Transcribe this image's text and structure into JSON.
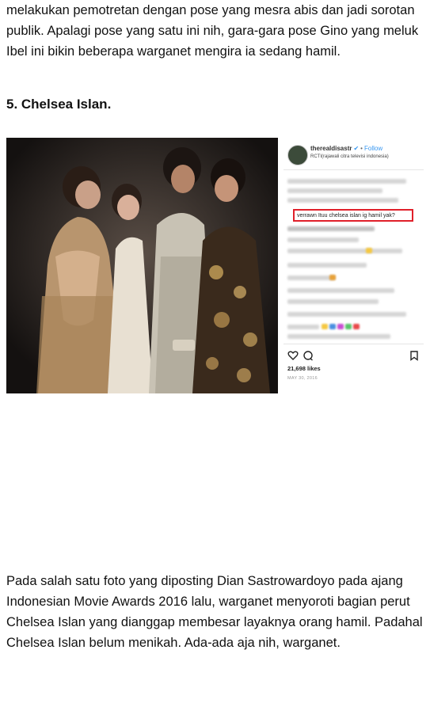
{
  "article": {
    "paragraph_top": "melakukan pemotretan dengan pose yang mesra abis dan jadi sorotan publik. Apalagi pose yang satu ini nih, gara-gara pose Gino yang meluk Ibel ini bikin beberapa warganet mengira ia sedang hamil.",
    "heading": "5. Chelsea Islan.",
    "paragraph_bottom": "Pada salah satu foto yang diposting Dian Sastrowardoyo pada ajang Indonesian Movie Awards 2016 lalu, warganet menyoroti bagian perut Chelsea Islan yang dianggap membesar layaknya orang hamil. Padahal Chelsea Islan belum menikah. Ada-ada aja nih, warganet."
  },
  "instagram": {
    "username": "therealdisastr",
    "verified_mark": "✔",
    "separator": "•",
    "follow_label": "Follow",
    "location": "RCTI(rajawali citra televisi indonesia)",
    "highlighted_comment": "verrawn Ituu chelsea islan ig hamil yak?",
    "likes": "21,698 likes",
    "date": "MAY 30, 2016",
    "emoji_colors": [
      "#f5c842",
      "#e8a23a",
      "#4a8fe0",
      "#c94fd1",
      "#5ac46a",
      "#e84a4a"
    ]
  }
}
